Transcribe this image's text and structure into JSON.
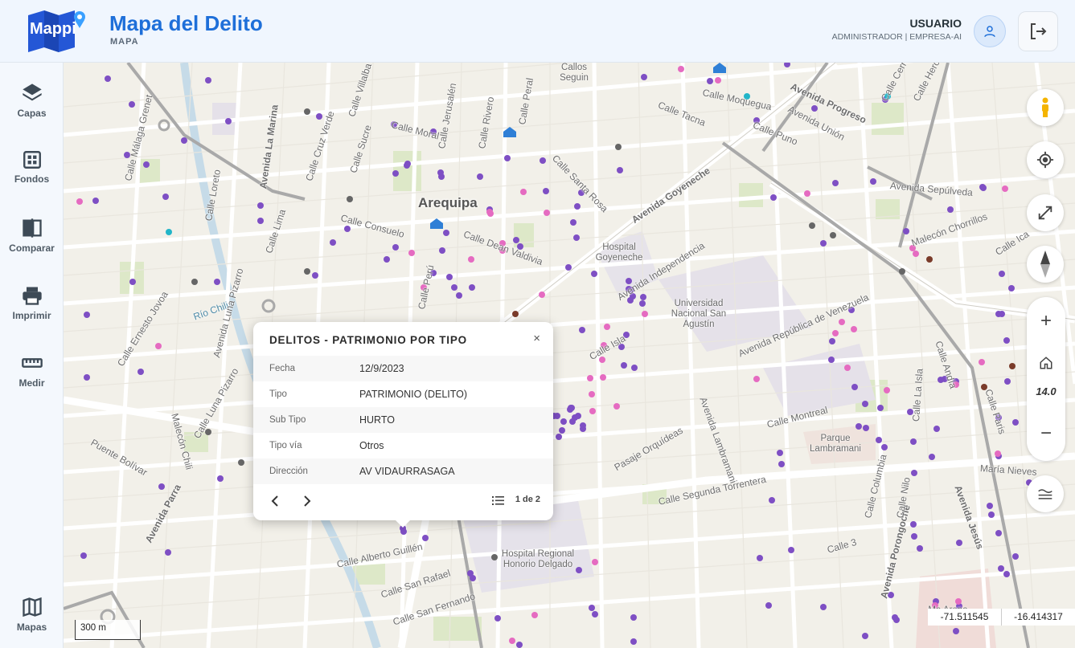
{
  "header": {
    "logo_text": "Mappi",
    "title": "Mapa del Delito",
    "subtitle": "MAPA",
    "user_name": "USUARIO",
    "user_role": "ADMINISTRADOR | EMPRESA-AI"
  },
  "sidebar": {
    "items": [
      {
        "label": "Capas",
        "icon": "layers-icon"
      },
      {
        "label": "Fondos",
        "icon": "grid-icon"
      },
      {
        "label": "Comparar",
        "icon": "compare-icon"
      },
      {
        "label": "Imprimir",
        "icon": "printer-icon"
      },
      {
        "label": "Medir",
        "icon": "ruler-icon"
      },
      {
        "label": "Mapas",
        "icon": "map-icon"
      }
    ]
  },
  "map": {
    "city": "Arequipa",
    "streets": [
      "Avenida La Marina",
      "Calle Mercaderes",
      "Calle Moral",
      "Calle Jerusalén",
      "Calle Rivero",
      "Calle Peral",
      "Calle Consuelo",
      "Calle Dean Valdivia",
      "Avenida Goyeneche",
      "Avenida Progreso",
      "Avenida Sepúlveda",
      "Avenida Independencia",
      "Avenida República de Venezuela",
      "Avenida Lambramani",
      "Calle Montreal",
      "Pasaje Orquídeas",
      "Calle Segunda Torrentera",
      "María Nieves",
      "Avenida Jesús",
      "Avenida Porongoche",
      "Avenida Parra",
      "Puente Bolívar",
      "Malecón Chili",
      "Río Chili",
      "Calle Tacna",
      "Calle Puno",
      "Avenida Unión",
      "Calle Santa Rosa",
      "Calle Alberto Guillén",
      "Calle San Rafael",
      "Calle San Fernando",
      "Calle Moquegua",
      "Calle Melgar",
      "Calle Isla",
      "Calle Andía",
      "Calle Paris",
      "Calle Ica",
      "Malecón Chorrillos",
      "Calle 3",
      "Calle Columbia",
      "Calle Nilo",
      "Calle La Isla",
      "Calle Villalba",
      "Calle Cruz Verde",
      "Calle Sucre",
      "Calle Loreto",
      "Calle Ernesto Jovoa",
      "Avenida Luna Pizarro",
      "Calle Luna Pizarro",
      "Calle Lima",
      "Calle Perú",
      "Calle Málaga Grenet",
      "Calle Heroes de",
      "Calle Cerro"
    ],
    "places": [
      {
        "name": "Hospital Goyeneche"
      },
      {
        "name": "Universidad Nacional San Agustín"
      },
      {
        "name": "Parque Lambramani"
      },
      {
        "name": "Hospital Regional Honorio Delgado"
      },
      {
        "name": "Callos Seguin"
      },
      {
        "name": "Ma Arena"
      }
    ]
  },
  "controls": {
    "zoom_in": "+",
    "zoom_out": "−",
    "zoom_level": "14.0"
  },
  "popup": {
    "title": "DELITOS - PATRIMONIO POR TIPO",
    "close": "×",
    "rows": [
      {
        "key": "Fecha",
        "value": "12/9/2023"
      },
      {
        "key": "Tipo",
        "value": "PATRIMONIO (DELITO)"
      },
      {
        "key": "Sub Tipo",
        "value": "HURTO"
      },
      {
        "key": "Tipo vía",
        "value": "Otros"
      },
      {
        "key": "Dirección",
        "value": "AV VIDAURRASAGA"
      }
    ],
    "pager": "1 de 2"
  },
  "scale": "300 m",
  "coords": {
    "lon": "-71.511545",
    "lat": "-16.414317"
  },
  "colors": {
    "accent": "#1e6fd9",
    "dot_purple": "#7e4fc4",
    "dot_gray": "#666666",
    "dot_pink": "#e56bc1",
    "dot_brown": "#7a3b2a",
    "dot_cyan": "#22b5c8"
  }
}
